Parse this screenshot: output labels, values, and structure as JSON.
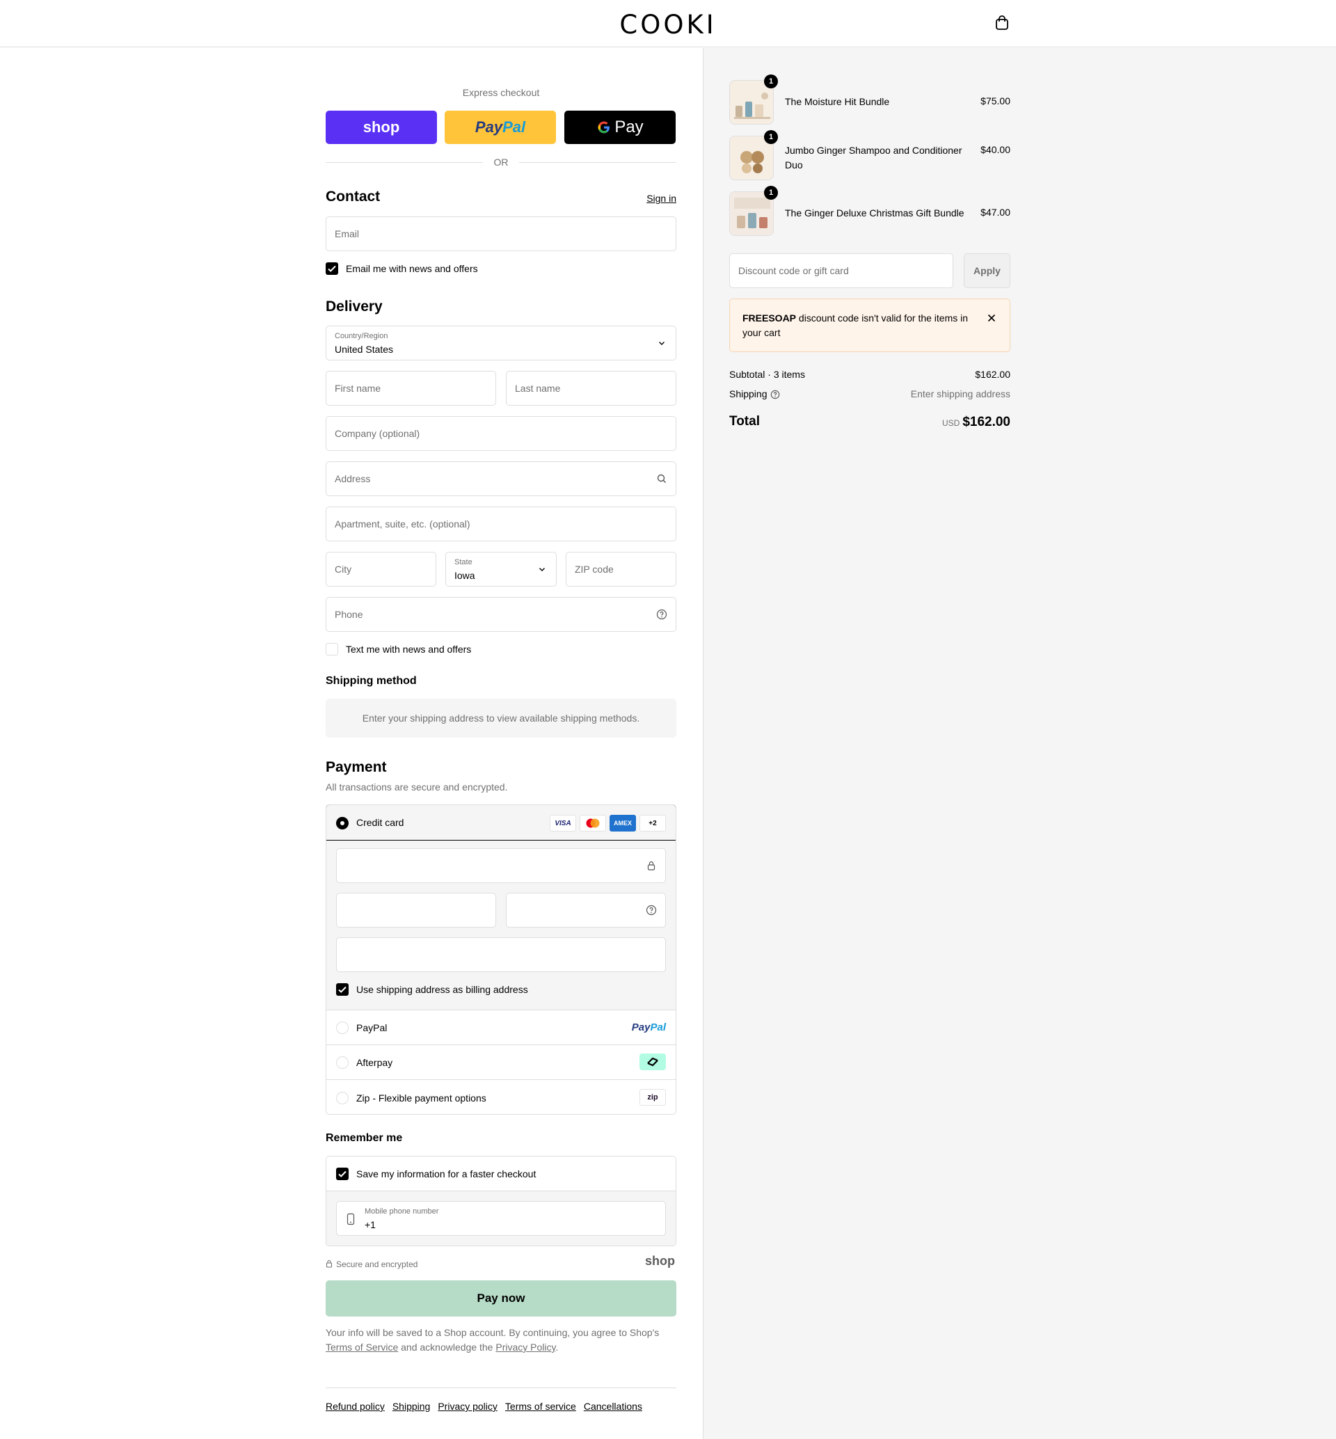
{
  "header": {
    "logo": "COOKI",
    "cart_icon": "shopping-bag-icon"
  },
  "express": {
    "label": "Express checkout",
    "shop_label": "shop",
    "paypal_label_1": "Pay",
    "paypal_label_2": "Pal",
    "gpay_label": "Pay",
    "or": "OR"
  },
  "contact": {
    "title": "Contact",
    "sign_in": "Sign in",
    "email_placeholder": "Email",
    "news_checkbox": "Email me with news and offers"
  },
  "delivery": {
    "title": "Delivery",
    "country_label": "Country/Region",
    "country_value": "United States",
    "first_name": "First name",
    "last_name": "Last name",
    "company": "Company (optional)",
    "address": "Address",
    "apartment": "Apartment, suite, etc. (optional)",
    "city": "City",
    "state_label": "State",
    "state_value": "Iowa",
    "zip": "ZIP code",
    "phone": "Phone",
    "text_checkbox": "Text me with news and offers"
  },
  "shipping_method": {
    "title": "Shipping method",
    "note": "Enter your shipping address to view available shipping methods."
  },
  "payment": {
    "title": "Payment",
    "subtitle": "All transactions are secure and encrypted.",
    "credit_card": "Credit card",
    "cards": {
      "visa": "VISA",
      "amex": "AMEX",
      "more": "+2"
    },
    "billing_checkbox": "Use shipping address as billing address",
    "paypal": "PayPal",
    "paypal_logo_1": "Pay",
    "paypal_logo_2": "Pal",
    "afterpay": "Afterpay",
    "zip": "Zip - Flexible payment options",
    "zip_logo": "zip"
  },
  "remember": {
    "title": "Remember me",
    "save_checkbox": "Save my information for a faster checkout",
    "mobile_label": "Mobile phone number",
    "mobile_value": "+1"
  },
  "secure": {
    "text": "Secure and encrypted",
    "shop_logo": "shop"
  },
  "pay_now": "Pay now",
  "disclaimer": {
    "text_1": "Your info will be saved to a Shop account. By continuing, you agree to Shop's",
    "terms": "Terms of Service",
    "text_2": "and acknowledge the",
    "privacy": "Privacy Policy",
    "text_3": "."
  },
  "footer": [
    "Refund policy",
    "Shipping",
    "Privacy policy",
    "Terms of service",
    "Cancellations"
  ],
  "cart": {
    "items": [
      {
        "name": "The Moisture Hit Bundle",
        "price": "$75.00",
        "qty": "1"
      },
      {
        "name": "Jumbo Ginger Shampoo and Conditioner Duo",
        "price": "$40.00",
        "qty": "1"
      },
      {
        "name": "The Ginger Deluxe Christmas Gift Bundle",
        "price": "$47.00",
        "qty": "1"
      }
    ],
    "discount_placeholder": "Discount code or gift card",
    "apply": "Apply",
    "alert_code": "FREESOAP",
    "alert_text": " discount code isn't valid for the items in your cart",
    "subtotal_label": "Subtotal · 3 items",
    "subtotal_value": "$162.00",
    "shipping_label": "Shipping",
    "shipping_value": "Enter shipping address",
    "total_label": "Total",
    "currency": "USD",
    "total_value": "$162.00"
  },
  "colors": {
    "shop": "#5a31f4",
    "paypal": "#ffc439",
    "pay_now": "#b6dbc7",
    "alert_bg": "#fff4ea"
  }
}
